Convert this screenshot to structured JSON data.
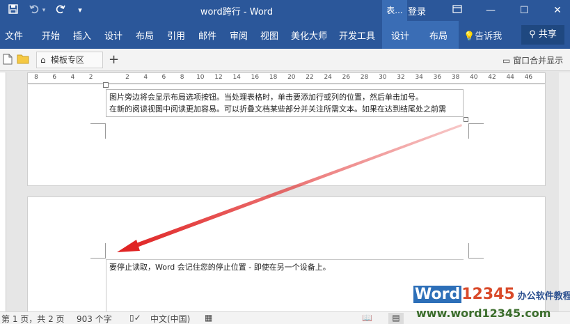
{
  "titlebar": {
    "doc_title": "word跨行 - Word",
    "ctx_tab": "表...",
    "login": "登录",
    "ribbon_display_icon": "ribbon-display-icon",
    "minimize_icon": "minimize-icon",
    "maximize_icon": "maximize-icon",
    "close_icon": "close-icon",
    "save_icon": "save-icon",
    "undo_icon": "undo-icon",
    "redo_icon": "redo-icon",
    "customize_icon": "customize-qat-icon"
  },
  "ribbon": {
    "tabs": [
      "文件",
      "开始",
      "插入",
      "设计",
      "布局",
      "引用",
      "邮件",
      "审阅",
      "视图",
      "美化大师",
      "开发工具"
    ],
    "context_tabs": [
      "设计",
      "布局"
    ],
    "tell_me": "告诉我",
    "share": "共享"
  },
  "toolbar": {
    "template_tab": "模板专区",
    "merge_window": "窗口合并显示"
  },
  "ruler": {
    "ticks": [
      "8",
      "6",
      "4",
      "2",
      "",
      "2",
      "4",
      "6",
      "8",
      "10",
      "12",
      "14",
      "16",
      "18",
      "20",
      "22",
      "24",
      "26",
      "28",
      "30",
      "32",
      "34",
      "36",
      "38",
      "40",
      "42",
      "44",
      "46"
    ]
  },
  "document": {
    "textbox_line1": "图片旁边将会显示布局选项按钮。当处理表格时，单击要添加行或列的位置，然后单击加号。",
    "textbox_line2": "在新的阅读视图中阅读更加容易。可以折叠文档某些部分并关注所需文本。如果在达到结尾处之前需",
    "page2_line": "要停止读取，Word 会记住您的停止位置 - 即使在另一个设备上。",
    "arrow_color": "#e02424"
  },
  "status": {
    "page": "第 1 页，共 2 页",
    "words": "903 个字",
    "language": "中文(中国)"
  },
  "watermark": {
    "logo_word": "Word",
    "logo_num": "12345",
    "logo_cn": "办公软件教程",
    "url": "www.word12345.com"
  }
}
